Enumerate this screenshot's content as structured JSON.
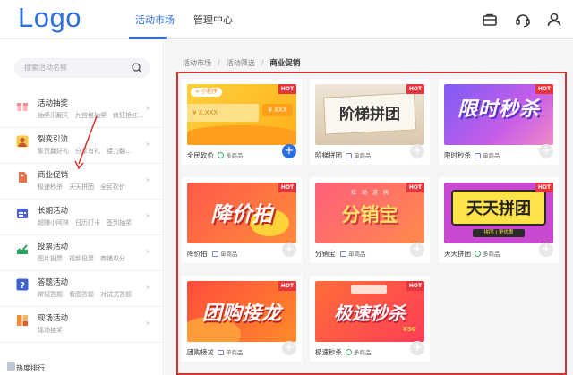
{
  "header": {
    "logo": "Logo",
    "tabs": [
      {
        "label": "活动市场"
      },
      {
        "label": "管理中心"
      }
    ],
    "accent_color": "#2d6fe0"
  },
  "sidebar": {
    "search_placeholder": "搜索活动名称",
    "items": [
      {
        "title": "活动抽奖",
        "sub": "抽奖乐翻天　九宫格抽奖　疯狂抢红...",
        "icon": "gift-icon"
      },
      {
        "title": "裂变引流",
        "sub": "集赞赢好礼　分享有礼　接力翻...",
        "icon": "person-icon"
      },
      {
        "title": "商业促销",
        "sub": "极速秒杀　天天拼团　全民砍价",
        "icon": "tag-icon"
      },
      {
        "title": "长期活动",
        "sub": "超赚小阿林　日历打卡　签到抽奖",
        "icon": "calendar-icon"
      },
      {
        "title": "投票活动",
        "sub": "图片投票　视频投票　商铺瓜分",
        "icon": "vote-icon"
      },
      {
        "title": "答题活动",
        "sub": "常规答题　看图答题　对试式答题",
        "icon": "question-icon"
      },
      {
        "title": "现场活动",
        "sub": "现场抽奖",
        "icon": "stage-icon"
      }
    ],
    "footer_label": "热度排行"
  },
  "breadcrumb": {
    "items": [
      "活动市场",
      "活动筛选"
    ],
    "current": "商业促销"
  },
  "cards": [
    {
      "name": "全民砍价",
      "tag": "多商品",
      "hot": "HOT",
      "mini": "小程序",
      "price": "¥ X.XXX",
      "price2": "¥ XXX",
      "active": true
    },
    {
      "name": "阶梯拼团",
      "tag": "单商品",
      "hot": "HOT",
      "banner": "阶梯拼团"
    },
    {
      "name": "限时秒杀",
      "tag": "单商品",
      "hot": "HOT",
      "banner": "限时秒杀"
    },
    {
      "name": "降价拍",
      "tag": "单商品",
      "hot": "HOT",
      "banner": "降价拍"
    },
    {
      "name": "分销宝",
      "tag": "单商品",
      "hot": "HOT",
      "banner": "分销宝",
      "banner_sub": "拉　动　进　阀"
    },
    {
      "name": "天天拼团",
      "tag": "多商品",
      "hot": "HOT",
      "banner": "天天拼团",
      "banner_sub": "拼团 | 更优惠"
    },
    {
      "name": "团购接龙",
      "tag": "单商品",
      "hot": "HOT",
      "banner": "团购接龙"
    },
    {
      "name": "极速秒杀",
      "tag": "多商品",
      "hot": "HOT",
      "banner": "极速秒杀",
      "banner_sub": "¥50"
    }
  ]
}
